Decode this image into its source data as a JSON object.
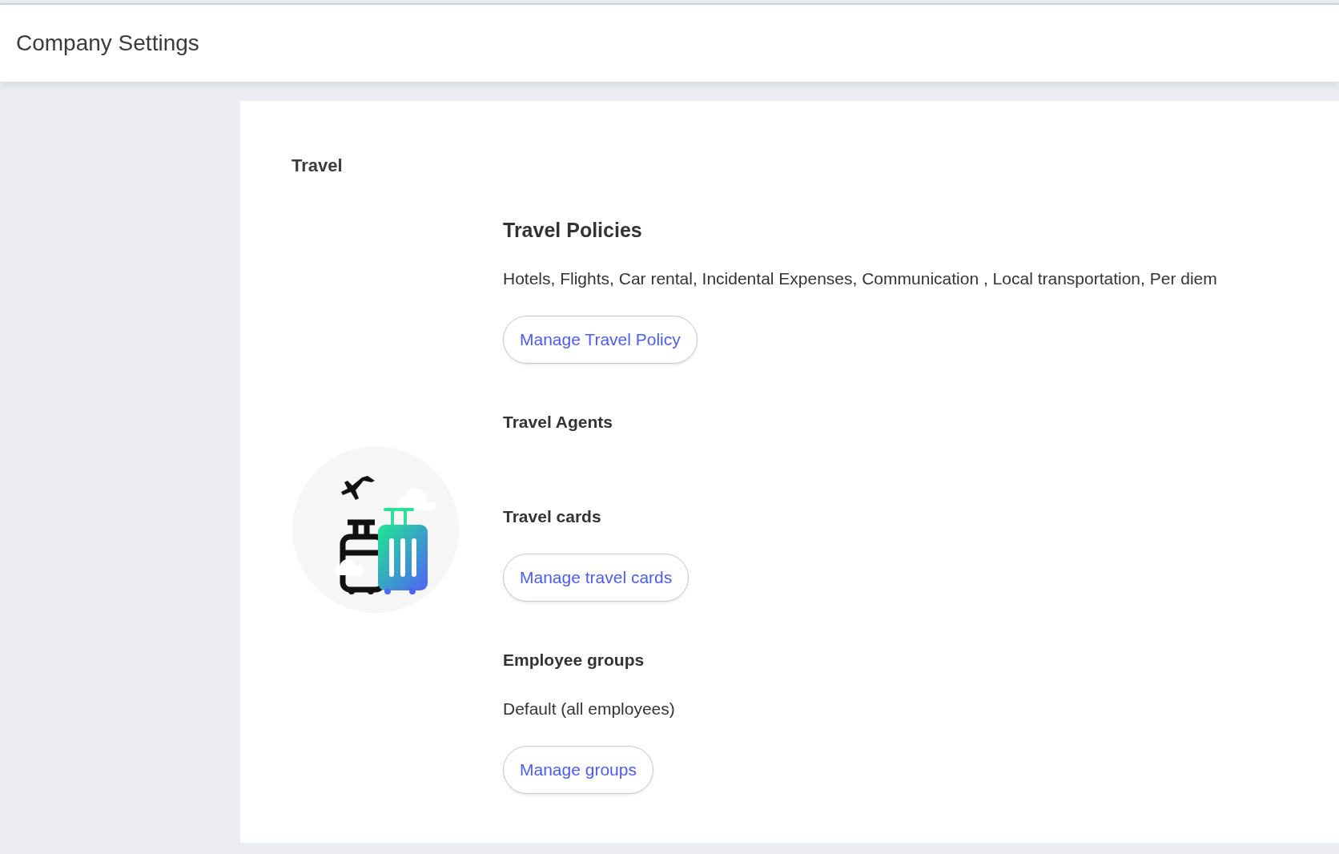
{
  "header": {
    "title": "Company Settings"
  },
  "card": {
    "title": "Travel",
    "sections": [
      {
        "kind": "primary",
        "title": "Travel Policies",
        "description": "Hotels, Flights, Car rental, Incidental Expenses, Communication , Local transportation, Per diem",
        "button": "Manage Travel Policy"
      },
      {
        "kind": "secondary",
        "title": "Travel Agents"
      },
      {
        "kind": "secondary",
        "title": "Travel cards",
        "button": "Manage travel cards"
      },
      {
        "kind": "secondary",
        "title": "Employee groups",
        "description": "Default (all employees)",
        "button": "Manage groups"
      }
    ]
  }
}
